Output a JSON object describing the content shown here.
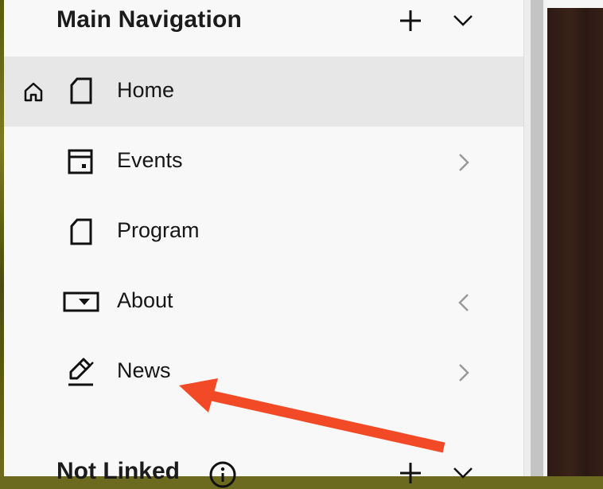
{
  "main_navigation": {
    "title": "Main Navigation",
    "add_icon": "plus-icon",
    "collapse_icon": "chevron-down-icon",
    "items": [
      {
        "label": "Home",
        "icon": "page-icon",
        "homepage_icon": "home-icon",
        "active": true
      },
      {
        "label": "Events",
        "icon": "calendar-page-icon",
        "has_children": true,
        "chevron": "chevron-right-icon"
      },
      {
        "label": "Program",
        "icon": "page-icon"
      },
      {
        "label": "About",
        "icon": "folder-dropdown-icon",
        "has_children": true,
        "chevron": "chevron-left-icon"
      },
      {
        "label": "News",
        "icon": "blog-pen-icon",
        "has_children": true,
        "chevron": "chevron-right-icon"
      }
    ]
  },
  "not_linked": {
    "title": "Not Linked",
    "info_icon": "info-icon",
    "add_icon": "plus-icon",
    "collapse_icon": "chevron-down-icon"
  },
  "annotation": {
    "arrow_color": "#f24a26",
    "points_to": "News"
  },
  "colors": {
    "panel_bg": "#f8f8f8",
    "active_row_bg": "#e7e7e7",
    "text": "#161616",
    "muted_icon": "#9a9a9a"
  }
}
